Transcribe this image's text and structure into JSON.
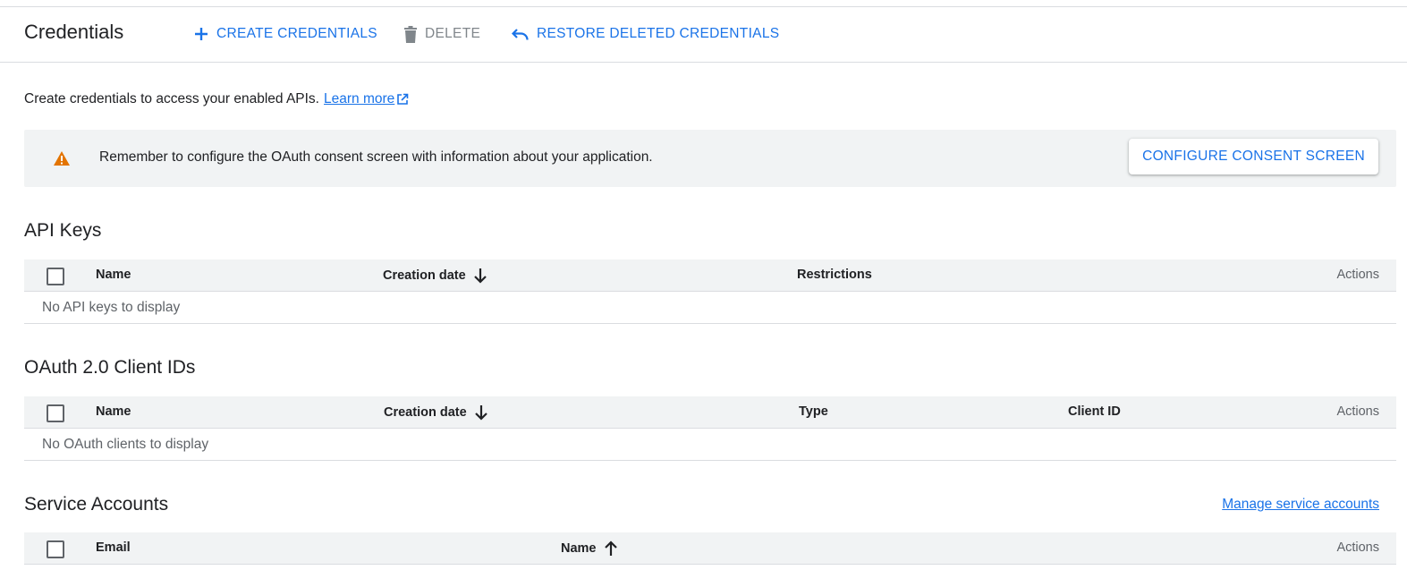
{
  "header": {
    "title": "Credentials",
    "create_label": "CREATE CREDENTIALS",
    "delete_label": "DELETE",
    "restore_label": "RESTORE DELETED CREDENTIALS"
  },
  "intro": {
    "text": "Create credentials to access your enabled APIs.",
    "link_label": "Learn more"
  },
  "banner": {
    "message": "Remember to configure the OAuth consent screen with information about your application.",
    "button_label": "CONFIGURE CONSENT SCREEN"
  },
  "api_keys": {
    "title": "API Keys",
    "columns": [
      "Name",
      "Creation date",
      "Restrictions",
      "Actions"
    ],
    "empty_text": "No API keys to display"
  },
  "oauth": {
    "title": "OAuth 2.0 Client IDs",
    "columns": [
      "Name",
      "Creation date",
      "Type",
      "Client ID",
      "Actions"
    ],
    "empty_text": "No OAuth clients to display"
  },
  "service_accounts": {
    "title": "Service Accounts",
    "manage_link": "Manage service accounts",
    "columns": [
      "Email",
      "Name",
      "Actions"
    ]
  },
  "colors": {
    "accent": "#1a73e8",
    "warning": "#e37400",
    "header_bg": "#f1f3f4"
  }
}
